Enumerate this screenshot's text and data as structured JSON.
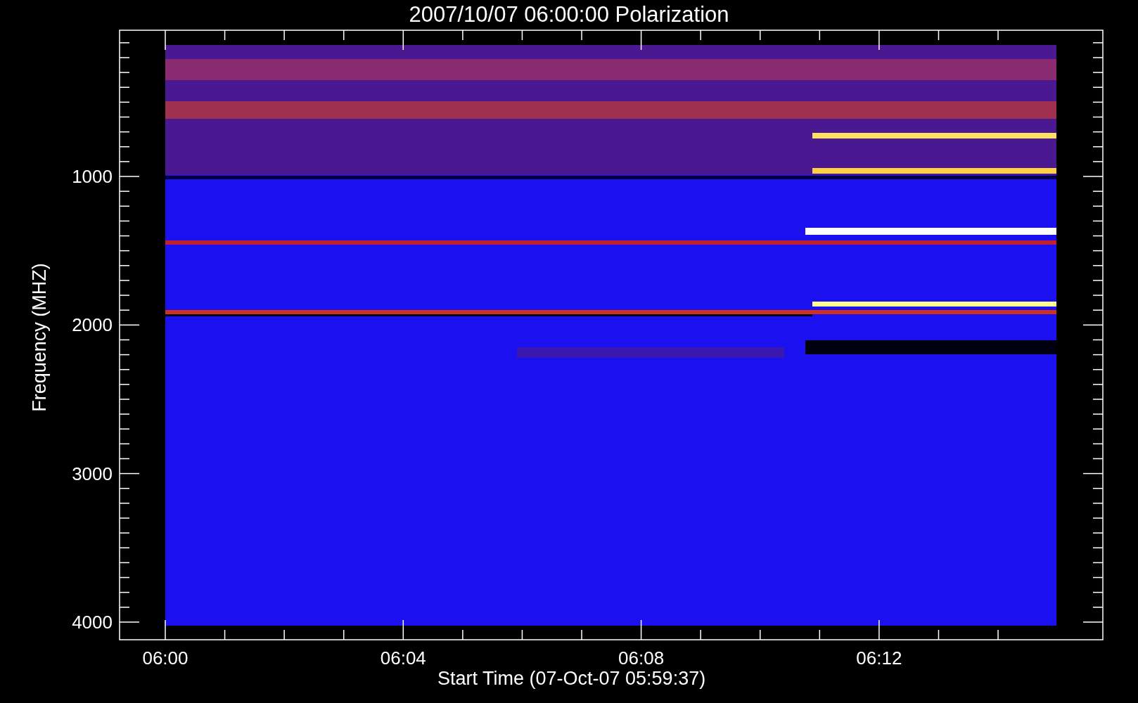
{
  "title": "2007/10/07 06:00:00 Polarization",
  "y_axis": {
    "label": "Frequency (MHZ)",
    "ticks": [
      "1000",
      "2000",
      "3000",
      "4000"
    ]
  },
  "x_axis": {
    "label": "Start Time (07-Oct-07 05:59:37)",
    "ticks": [
      "06:00",
      "06:04",
      "06:08",
      "06:12"
    ]
  }
}
